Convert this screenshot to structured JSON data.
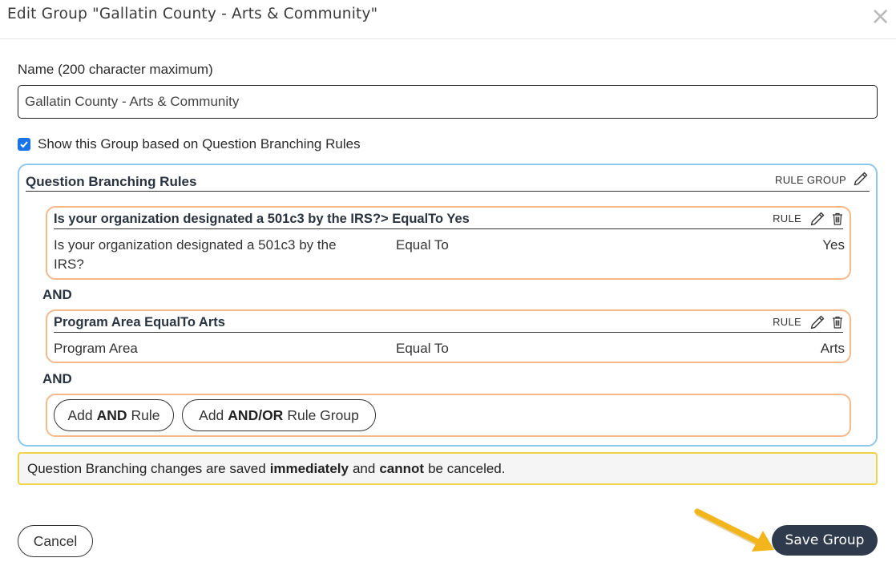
{
  "modal": {
    "title": "Edit Group \"Gallatin County - Arts & Community\"",
    "close_icon": "close-icon"
  },
  "name_field": {
    "label": "Name (200 character maximum)",
    "value": "Gallatin County - Arts & Community"
  },
  "show_branching": {
    "checked": true,
    "label": "Show this Group based on Question Branching Rules"
  },
  "rule_group": {
    "title": "Question Branching Rules",
    "tag": "RULE GROUP",
    "rules": [
      {
        "title": "Is your organization designated a 501c3 by the IRS?> EqualTo Yes",
        "tag": "RULE",
        "question_line1": "Is your organization designated a 501c3 by the",
        "question_line2": "IRS?",
        "operator": "Equal To",
        "value": "Yes"
      },
      {
        "title": "Program Area EqualTo Arts",
        "tag": "RULE",
        "question": "Program Area",
        "operator": "Equal To",
        "value": "Arts"
      }
    ],
    "connectors": [
      "AND",
      "AND"
    ],
    "add_and_rule": {
      "prefix": "Add",
      "bold": "AND",
      "suffix": "Rule"
    },
    "add_and_or_group": {
      "prefix": "Add",
      "bold": "AND/OR",
      "suffix": "Rule Group"
    }
  },
  "notice": {
    "part1": "Question Branching changes are saved",
    "bold1": "immediately",
    "part2": "and",
    "bold2": "cannot",
    "part3": "be canceled."
  },
  "footer": {
    "cancel_label": "Cancel",
    "save_label": "Save Group"
  },
  "colors": {
    "rule_group_border": "#8cc8f0",
    "rule_border": "#f5b98a",
    "notice_border": "#f0d34a",
    "save_button_bg": "#2f3b4c",
    "annotation_arrow": "#f2b51c",
    "checkbox": "#1a73e8"
  }
}
